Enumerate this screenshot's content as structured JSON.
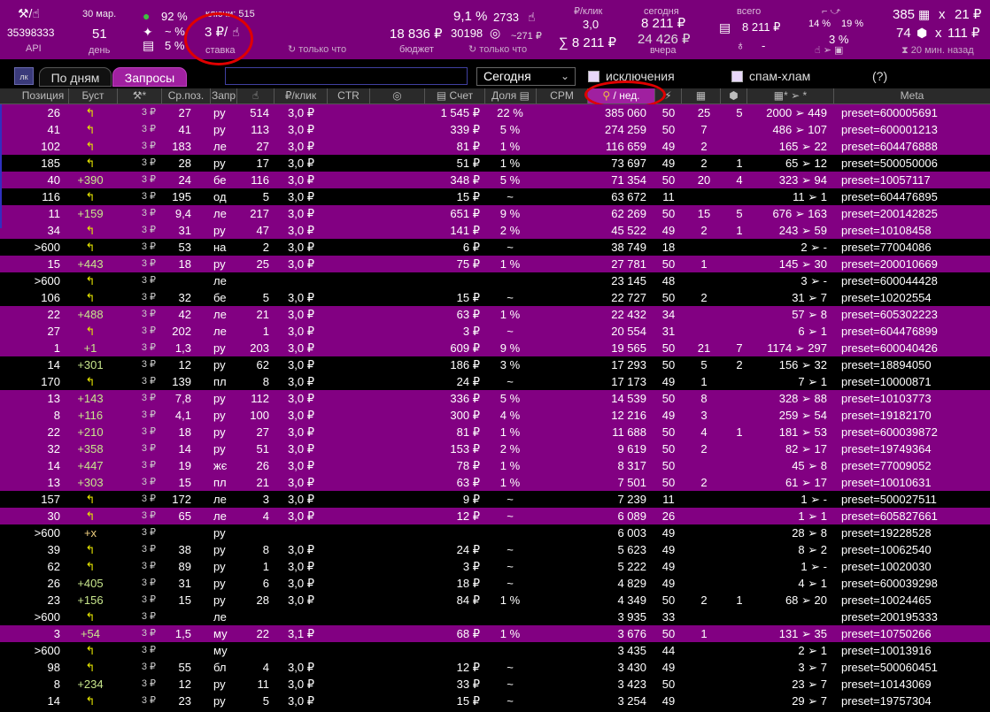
{
  "topbar": {
    "api_id": "35398333",
    "api_label": "API",
    "date": "30 мар.",
    "day_number": "51",
    "day_label": "день",
    "pct_1": "92 %",
    "pct_2": "~ %",
    "pct_3": "5 %",
    "keys_label": "ключи: 515",
    "bid_value": "3 ₽/",
    "bid_label": "ставка",
    "only_now_1": "только что",
    "budget_value": "18 836 ₽",
    "budget_label": "бюджет",
    "ctr_value": "9,1 %",
    "clicks_value": "2733",
    "views_value": "30198",
    "views_sub": "~271 ₽",
    "only_now_2": "только что",
    "per_click_label": "₽/клик",
    "per_click_value": "3,0",
    "sum_value": "∑ 8 211 ₽",
    "today_label": "сегодня",
    "today_value": "8 211 ₽",
    "yesterday_value": "24 426 ₽",
    "yesterday_label": "вчера",
    "total_label": "всего",
    "total_value": "8 211 ₽",
    "total_dash": "-",
    "pct_14": "14 %",
    "pct_19": "19 %",
    "pct_3b": "3 %",
    "cart_count": "385",
    "cart_x": "x",
    "cart_price": "21 ₽",
    "box_count": "74",
    "box_x": "x",
    "box_price": "111 ₽",
    "ago": "20 мин. назад"
  },
  "controls": {
    "lk": "лк",
    "tab_days": "По дням",
    "tab_queries": "Запросы",
    "period": "Сегодня",
    "exclusions": "исключения",
    "spam": "спам-хлам",
    "help": "(?)"
  },
  "columns": [
    "Позиция",
    "Буст",
    "*",
    "Ср.поз.",
    "Запр",
    "",
    "₽/клик",
    "CTR",
    "",
    "Счет",
    "Доля",
    "CPM",
    "/ нед.",
    "",
    "",
    "",
    "* ➢ *",
    "Meta"
  ],
  "rows": [
    {
      "hl": true,
      "pos": "26",
      "boost": "↰",
      "bid": "3 ₽",
      "avg": "27",
      "q": "ру",
      "clicks": "514",
      "cpc": "3,0 ₽",
      "bill": "1 545 ₽",
      "share": "22 %",
      "week": "385 060",
      "n": "50",
      "cart": "25",
      "box": "5",
      "funnel": "2000 ➢ 449",
      "meta": "preset=600005691"
    },
    {
      "hl": true,
      "pos": "41",
      "boost": "↰",
      "bid": "3 ₽",
      "avg": "41",
      "q": "ру",
      "clicks": "113",
      "cpc": "3,0 ₽",
      "bill": "339 ₽",
      "share": "5 %",
      "week": "274 259",
      "n": "50",
      "cart": "7",
      "box": "",
      "funnel": "486 ➢ 107",
      "meta": "preset=600001213"
    },
    {
      "hl": true,
      "pos": "102",
      "boost": "↰",
      "bid": "3 ₽",
      "avg": "183",
      "q": "ле",
      "clicks": "27",
      "cpc": "3,0 ₽",
      "bill": "81 ₽",
      "share": "1 %",
      "week": "116 659",
      "n": "49",
      "cart": "2",
      "box": "",
      "funnel": "165 ➢ 22",
      "meta": "preset=604476888"
    },
    {
      "hl": false,
      "pos": "185",
      "boost": "↰",
      "bid": "3 ₽",
      "avg": "28",
      "q": "ру",
      "clicks": "17",
      "cpc": "3,0 ₽",
      "bill": "51 ₽",
      "share": "1 %",
      "week": "73 697",
      "n": "49",
      "cart": "2",
      "box": "1",
      "funnel": "65 ➢ 12",
      "meta": "preset=500050006"
    },
    {
      "hl": true,
      "pos": "40",
      "boost": "+390",
      "bid": "3 ₽",
      "avg": "24",
      "q": "бе",
      "clicks": "116",
      "cpc": "3,0 ₽",
      "bill": "348 ₽",
      "share": "5 %",
      "week": "71 354",
      "n": "50",
      "cart": "20",
      "box": "4",
      "funnel": "323 ➢ 94",
      "meta": "preset=10057117"
    },
    {
      "hl": false,
      "pos": "116",
      "boost": "↰",
      "bid": "3 ₽",
      "avg": "195",
      "q": "од",
      "clicks": "5",
      "cpc": "3,0 ₽",
      "bill": "15 ₽",
      "share": "~",
      "week": "63 672",
      "n": "11",
      "cart": "",
      "box": "",
      "funnel": "11 ➢ 1",
      "meta": "preset=604476895"
    },
    {
      "hl": true,
      "pos": "11",
      "boost": "+159",
      "bid": "3 ₽",
      "avg": "9,4",
      "q": "ле",
      "clicks": "217",
      "cpc": "3,0 ₽",
      "bill": "651 ₽",
      "share": "9 %",
      "week": "62 269",
      "n": "50",
      "cart": "15",
      "box": "5",
      "funnel": "676 ➢ 163",
      "meta": "preset=200142825"
    },
    {
      "hl": true,
      "pos": "34",
      "boost": "↰",
      "bid": "3 ₽",
      "avg": "31",
      "q": "ру",
      "clicks": "47",
      "cpc": "3,0 ₽",
      "bill": "141 ₽",
      "share": "2 %",
      "week": "45 522",
      "n": "49",
      "cart": "2",
      "box": "1",
      "funnel": "243 ➢ 59",
      "meta": "preset=10108458"
    },
    {
      "hl": false,
      "pos": ">600",
      "boost": "↰",
      "bid": "3 ₽",
      "avg": "53",
      "q": "на",
      "clicks": "2",
      "cpc": "3,0 ₽",
      "bill": "6 ₽",
      "share": "~",
      "week": "38 749",
      "n": "18",
      "cart": "",
      "box": "",
      "funnel": "2 ➢ -",
      "meta": "preset=77004086"
    },
    {
      "hl": true,
      "pos": "15",
      "boost": "+443",
      "bid": "3 ₽",
      "avg": "18",
      "q": "ру",
      "clicks": "25",
      "cpc": "3,0 ₽",
      "bill": "75 ₽",
      "share": "1 %",
      "week": "27 781",
      "n": "50",
      "cart": "1",
      "box": "",
      "funnel": "145 ➢ 30",
      "meta": "preset=200010669"
    },
    {
      "hl": false,
      "pos": ">600",
      "boost": "↰",
      "bid": "3 ₽",
      "avg": "",
      "q": "ле",
      "clicks": "",
      "cpc": "",
      "bill": "",
      "share": "",
      "week": "23 145",
      "n": "48",
      "cart": "",
      "box": "",
      "funnel": "3 ➢ -",
      "meta": "preset=600044428"
    },
    {
      "hl": false,
      "pos": "106",
      "boost": "↰",
      "bid": "3 ₽",
      "avg": "32",
      "q": "бе",
      "clicks": "5",
      "cpc": "3,0 ₽",
      "bill": "15 ₽",
      "share": "~",
      "week": "22 727",
      "n": "50",
      "cart": "2",
      "box": "",
      "funnel": "31 ➢ 7",
      "meta": "preset=10202554"
    },
    {
      "hl": true,
      "pos": "22",
      "boost": "+488",
      "bid": "3 ₽",
      "avg": "42",
      "q": "ле",
      "clicks": "21",
      "cpc": "3,0 ₽",
      "bill": "63 ₽",
      "share": "1 %",
      "week": "22 432",
      "n": "34",
      "cart": "",
      "box": "",
      "funnel": "57 ➢ 8",
      "meta": "preset=605302223"
    },
    {
      "hl": true,
      "pos": "27",
      "boost": "↰",
      "bid": "3 ₽",
      "avg": "202",
      "q": "ле",
      "clicks": "1",
      "cpc": "3,0 ₽",
      "bill": "3 ₽",
      "share": "~",
      "week": "20 554",
      "n": "31",
      "cart": "",
      "box": "",
      "funnel": "6 ➢ 1",
      "meta": "preset=604476899"
    },
    {
      "hl": true,
      "pos": "1",
      "boost": "+1",
      "bid": "3 ₽",
      "avg": "1,3",
      "q": "ру",
      "clicks": "203",
      "cpc": "3,0 ₽",
      "bill": "609 ₽",
      "share": "9 %",
      "week": "19 565",
      "n": "50",
      "cart": "21",
      "box": "7",
      "funnel": "1174 ➢ 297",
      "meta": "preset=600040426"
    },
    {
      "hl": false,
      "pos": "14",
      "boost": "+301",
      "bid": "3 ₽",
      "avg": "12",
      "q": "ру",
      "clicks": "62",
      "cpc": "3,0 ₽",
      "bill": "186 ₽",
      "share": "3 %",
      "week": "17 293",
      "n": "50",
      "cart": "5",
      "box": "2",
      "funnel": "156 ➢ 32",
      "meta": "preset=18894050"
    },
    {
      "hl": false,
      "pos": "170",
      "boost": "↰",
      "bid": "3 ₽",
      "avg": "139",
      "q": "пл",
      "clicks": "8",
      "cpc": "3,0 ₽",
      "bill": "24 ₽",
      "share": "~",
      "week": "17 173",
      "n": "49",
      "cart": "1",
      "box": "",
      "funnel": "7 ➢ 1",
      "meta": "preset=10000871"
    },
    {
      "hl": true,
      "pos": "13",
      "boost": "+143",
      "bid": "3 ₽",
      "avg": "7,8",
      "q": "ру",
      "clicks": "112",
      "cpc": "3,0 ₽",
      "bill": "336 ₽",
      "share": "5 %",
      "week": "14 539",
      "n": "50",
      "cart": "8",
      "box": "",
      "funnel": "328 ➢ 88",
      "meta": "preset=10103773"
    },
    {
      "hl": true,
      "pos": "8",
      "boost": "+116",
      "bid": "3 ₽",
      "avg": "4,1",
      "q": "ру",
      "clicks": "100",
      "cpc": "3,0 ₽",
      "bill": "300 ₽",
      "share": "4 %",
      "week": "12 216",
      "n": "49",
      "cart": "3",
      "box": "",
      "funnel": "259 ➢ 54",
      "meta": "preset=19182170"
    },
    {
      "hl": true,
      "pos": "22",
      "boost": "+210",
      "bid": "3 ₽",
      "avg": "18",
      "q": "ру",
      "clicks": "27",
      "cpc": "3,0 ₽",
      "bill": "81 ₽",
      "share": "1 %",
      "week": "11 688",
      "n": "50",
      "cart": "4",
      "box": "1",
      "funnel": "181 ➢ 53",
      "meta": "preset=600039872"
    },
    {
      "hl": true,
      "pos": "32",
      "boost": "+358",
      "bid": "3 ₽",
      "avg": "14",
      "q": "ру",
      "clicks": "51",
      "cpc": "3,0 ₽",
      "bill": "153 ₽",
      "share": "2 %",
      "week": "9 619",
      "n": "50",
      "cart": "2",
      "box": "",
      "funnel": "82 ➢ 17",
      "meta": "preset=19749364"
    },
    {
      "hl": true,
      "pos": "14",
      "boost": "+447",
      "bid": "3 ₽",
      "avg": "19",
      "q": "жє",
      "clicks": "26",
      "cpc": "3,0 ₽",
      "bill": "78 ₽",
      "share": "1 %",
      "week": "8 317",
      "n": "50",
      "cart": "",
      "box": "",
      "funnel": "45 ➢ 8",
      "meta": "preset=77009052"
    },
    {
      "hl": true,
      "pos": "13",
      "boost": "+303",
      "bid": "3 ₽",
      "avg": "15",
      "q": "пл",
      "clicks": "21",
      "cpc": "3,0 ₽",
      "bill": "63 ₽",
      "share": "1 %",
      "week": "7 501",
      "n": "50",
      "cart": "2",
      "box": "",
      "funnel": "61 ➢ 17",
      "meta": "preset=10010631"
    },
    {
      "hl": false,
      "pos": "157",
      "boost": "↰",
      "bid": "3 ₽",
      "avg": "172",
      "q": "ле",
      "clicks": "3",
      "cpc": "3,0 ₽",
      "bill": "9 ₽",
      "share": "~",
      "week": "7 239",
      "n": "11",
      "cart": "",
      "box": "",
      "funnel": "1 ➢ -",
      "meta": "preset=500027511"
    },
    {
      "hl": true,
      "pos": "30",
      "boost": "↰",
      "bid": "3 ₽",
      "avg": "65",
      "q": "ле",
      "clicks": "4",
      "cpc": "3,0 ₽",
      "bill": "12 ₽",
      "share": "~",
      "week": "6 089",
      "n": "26",
      "cart": "",
      "box": "",
      "funnel": "1 ➢ 1",
      "meta": "preset=605827661"
    },
    {
      "hl": false,
      "pos": ">600",
      "boost": "+x",
      "bid": "3 ₽",
      "avg": "",
      "q": "ру",
      "clicks": "",
      "cpc": "",
      "bill": "",
      "share": "",
      "week": "6 003",
      "n": "49",
      "cart": "",
      "box": "",
      "funnel": "28 ➢ 8",
      "meta": "preset=19228528"
    },
    {
      "hl": false,
      "pos": "39",
      "boost": "↰",
      "bid": "3 ₽",
      "avg": "38",
      "q": "ру",
      "clicks": "8",
      "cpc": "3,0 ₽",
      "bill": "24 ₽",
      "share": "~",
      "week": "5 623",
      "n": "49",
      "cart": "",
      "box": "",
      "funnel": "8 ➢ 2",
      "meta": "preset=10062540"
    },
    {
      "hl": false,
      "pos": "62",
      "boost": "↰",
      "bid": "3 ₽",
      "avg": "89",
      "q": "ру",
      "clicks": "1",
      "cpc": "3,0 ₽",
      "bill": "3 ₽",
      "share": "~",
      "week": "5 222",
      "n": "49",
      "cart": "",
      "box": "",
      "funnel": "1 ➢ -",
      "meta": "preset=10020030"
    },
    {
      "hl": false,
      "pos": "26",
      "boost": "+405",
      "bid": "3 ₽",
      "avg": "31",
      "q": "ру",
      "clicks": "6",
      "cpc": "3,0 ₽",
      "bill": "18 ₽",
      "share": "~",
      "week": "4 829",
      "n": "49",
      "cart": "",
      "box": "",
      "funnel": "4 ➢ 1",
      "meta": "preset=600039298"
    },
    {
      "hl": false,
      "pos": "23",
      "boost": "+156",
      "bid": "3 ₽",
      "avg": "15",
      "q": "ру",
      "clicks": "28",
      "cpc": "3,0 ₽",
      "bill": "84 ₽",
      "share": "1 %",
      "week": "4 349",
      "n": "50",
      "cart": "2",
      "box": "1",
      "funnel": "68 ➢ 20",
      "meta": "preset=10024465"
    },
    {
      "hl": false,
      "pos": ">600",
      "boost": "↰",
      "bid": "3 ₽",
      "avg": "",
      "q": "ле",
      "clicks": "",
      "cpc": "",
      "bill": "",
      "share": "",
      "week": "3 935",
      "n": "33",
      "cart": "",
      "box": "",
      "funnel": "",
      "meta": "preset=200195333"
    },
    {
      "hl": true,
      "pos": "3",
      "boost": "+54",
      "bid": "3 ₽",
      "avg": "1,5",
      "q": "му",
      "clicks": "22",
      "cpc": "3,1 ₽",
      "bill": "68 ₽",
      "share": "1 %",
      "week": "3 676",
      "n": "50",
      "cart": "1",
      "box": "",
      "funnel": "131 ➢ 35",
      "meta": "preset=10750266"
    },
    {
      "hl": false,
      "pos": ">600",
      "boost": "↰",
      "bid": "3 ₽",
      "avg": "",
      "q": "му",
      "clicks": "",
      "cpc": "",
      "bill": "",
      "share": "",
      "week": "3 435",
      "n": "44",
      "cart": "",
      "box": "",
      "funnel": "2 ➢ 1",
      "meta": "preset=10013916"
    },
    {
      "hl": false,
      "pos": "98",
      "boost": "↰",
      "bid": "3 ₽",
      "avg": "55",
      "q": "бл",
      "clicks": "4",
      "cpc": "3,0 ₽",
      "bill": "12 ₽",
      "share": "~",
      "week": "3 430",
      "n": "49",
      "cart": "",
      "box": "",
      "funnel": "3 ➢ 7",
      "meta": "preset=500060451"
    },
    {
      "hl": false,
      "pos": "8",
      "boost": "+234",
      "bid": "3 ₽",
      "avg": "12",
      "q": "ру",
      "clicks": "11",
      "cpc": "3,0 ₽",
      "bill": "33 ₽",
      "share": "~",
      "week": "3 423",
      "n": "50",
      "cart": "",
      "box": "",
      "funnel": "23 ➢ 7",
      "meta": "preset=10143069"
    },
    {
      "hl": false,
      "pos": "14",
      "boost": "↰",
      "bid": "3 ₽",
      "avg": "23",
      "q": "ру",
      "clicks": "5",
      "cpc": "3,0 ₽",
      "bill": "15 ₽",
      "share": "~",
      "week": "3 254",
      "n": "49",
      "cart": "",
      "box": "",
      "funnel": "29 ➢ 7",
      "meta": "preset=19757304"
    }
  ]
}
